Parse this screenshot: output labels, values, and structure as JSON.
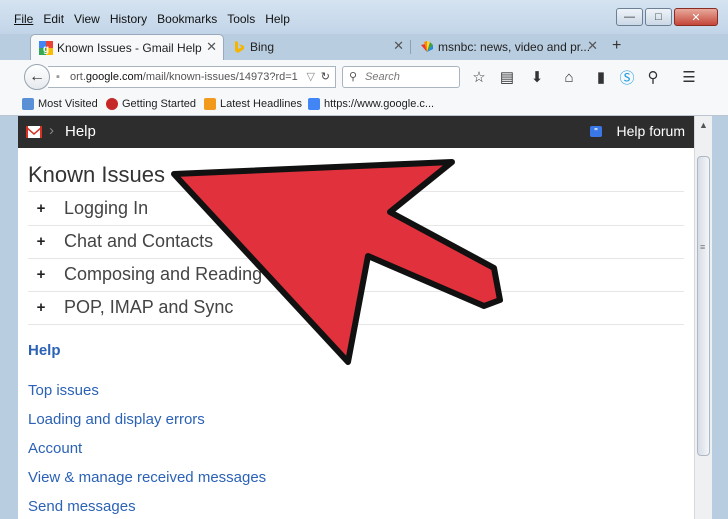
{
  "menubar": {
    "items": [
      "File",
      "Edit",
      "View",
      "History",
      "Bookmarks",
      "Tools",
      "Help"
    ]
  },
  "window_controls": {
    "minimize": "—",
    "maximize": "□",
    "close": "✕"
  },
  "tabs": [
    {
      "title": "Known Issues - Gmail Help",
      "favicon": "google-g-icon",
      "active": true
    },
    {
      "title": "Bing",
      "favicon": "bing-icon",
      "active": false
    },
    {
      "title": "msnbc: news, video and pr...",
      "favicon": "nbc-peacock-icon",
      "active": false
    }
  ],
  "new_tab_label": "+",
  "navbar": {
    "url_prefix": "ort.",
    "url_domain": "google.com",
    "url_path": "/mail/known-issues/14973?rd=1",
    "search_placeholder": "Search"
  },
  "bookmarks": [
    {
      "label": "Most Visited",
      "icon": "most-visited-icon"
    },
    {
      "label": "Getting Started",
      "icon": "firefox-icon"
    },
    {
      "label": "Latest Headlines",
      "icon": "rss-icon"
    },
    {
      "label": "https://www.google.c...",
      "icon": "google-icon"
    }
  ],
  "gmail_bar": {
    "section": "Help",
    "forum_label": "Help forum"
  },
  "known_issues": {
    "title": "Known Issues",
    "items": [
      "Logging In",
      "Chat and Contacts",
      "Composing and Reading Mail",
      "POP, IMAP and Sync"
    ]
  },
  "help_section": {
    "heading": "Help",
    "links": [
      "Top issues",
      "Loading and display errors",
      "Account",
      "View & manage received messages",
      "Send messages"
    ]
  },
  "colors": {
    "arrow_fill": "#e0313c",
    "link": "#2b62b6",
    "gmail_bar": "#2d2d2d"
  }
}
